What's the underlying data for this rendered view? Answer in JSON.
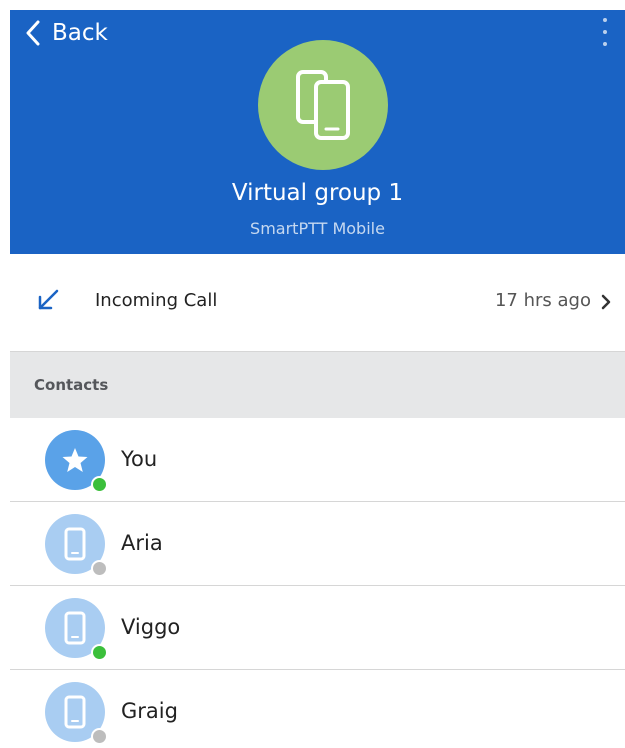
{
  "header": {
    "back_label": "Back",
    "title": "Virtual group 1",
    "subtitle": "SmartPTT Mobile",
    "background": "#1a63c4",
    "avatar_color": "#9bcb73",
    "avatar_icon": "devices-icon"
  },
  "recent_call": {
    "label": "Incoming Call",
    "time": "17 hrs ago",
    "icon": "incoming-call-arrow-icon",
    "icon_color": "#1a63c4"
  },
  "contacts": {
    "section_title": "Contacts",
    "items": [
      {
        "name": "You",
        "avatar_icon": "star-icon",
        "avatar_color": "#5aa2e8",
        "status": "online",
        "status_color": "#3bbf3b"
      },
      {
        "name": "Aria",
        "avatar_icon": "phone-icon",
        "avatar_color": "#a9cdf2",
        "status": "offline",
        "status_color": "#bdbdbd"
      },
      {
        "name": "Viggo",
        "avatar_icon": "phone-icon",
        "avatar_color": "#a9cdf2",
        "status": "online",
        "status_color": "#3bbf3b"
      },
      {
        "name": "Graig",
        "avatar_icon": "phone-icon",
        "avatar_color": "#a9cdf2",
        "status": "offline",
        "status_color": "#bdbdbd"
      }
    ]
  }
}
